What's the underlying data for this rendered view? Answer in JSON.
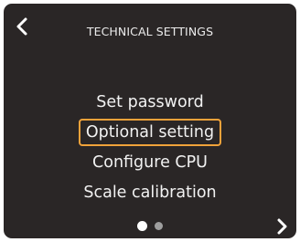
{
  "header": {
    "title": "TECHNICAL SETTINGS",
    "back_icon": "chevron-left-icon"
  },
  "menu": {
    "items": [
      {
        "label": "Set password",
        "selected": false
      },
      {
        "label": "Optional setting",
        "selected": true
      },
      {
        "label": "Configure CPU",
        "selected": false
      },
      {
        "label": "Scale calibration",
        "selected": false
      }
    ]
  },
  "pagination": {
    "current_page": 1,
    "total_pages": 2
  },
  "footer": {
    "next_icon": "chevron-right-icon"
  },
  "colors": {
    "background": "#2a2626",
    "text": "#f2f2f2",
    "selection_border": "#f0a23a",
    "dot_active": "#ffffff",
    "dot_inactive": "#9e9e9e"
  }
}
